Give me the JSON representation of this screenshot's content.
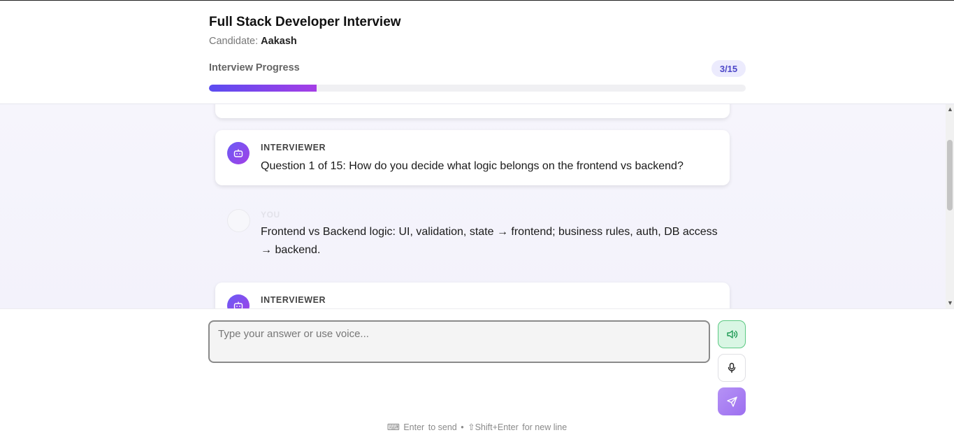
{
  "header": {
    "title": "Full Stack Developer Interview",
    "candidate_label": "Candidate:",
    "candidate_name": "Aakash",
    "progress_label": "Interview Progress",
    "progress_text": "3/15",
    "progress_fraction": 0.2
  },
  "chat": {
    "messages": [
      {
        "role": "INTERVIEWER",
        "text": "Question 1 of 15: How do you decide what logic belongs on the frontend vs backend?"
      },
      {
        "role": "YOU",
        "text": "Frontend vs Backend logic: UI, validation, state → frontend; business rules, auth, DB access → backend."
      },
      {
        "role": "INTERVIEWER",
        "text": ""
      }
    ]
  },
  "input": {
    "placeholder": "Type your answer or use voice...",
    "value": ""
  },
  "hint": {
    "enter_key": "Enter",
    "enter_action": "to send",
    "separator": "•",
    "shift_key": "⇧Shift+Enter",
    "shift_action": "for new line"
  },
  "colors": {
    "accent": "#5b4cf0",
    "accent2": "#a53ee6",
    "speaker_bg": "#d9f6e4",
    "speaker_border": "#5cc983",
    "send_bg": "#b592f5"
  }
}
